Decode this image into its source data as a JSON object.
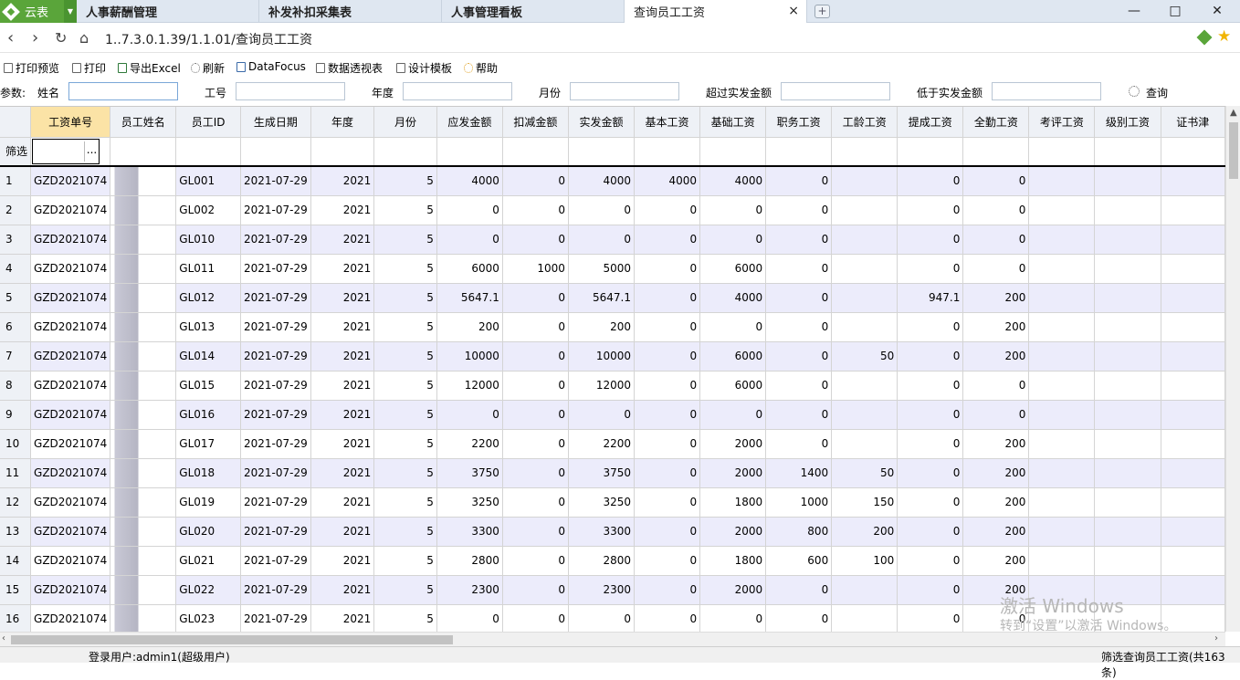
{
  "tabs": {
    "logo_label": "云表",
    "items": [
      "人事薪酬管理",
      "补发补扣采集表",
      "人事管理看板",
      "查询员工工资"
    ],
    "close_glyph": "×",
    "new_glyph": "+"
  },
  "window": {
    "minimize": "—",
    "maximize": "□",
    "close": "✕"
  },
  "address": {
    "url": "1..7.3.0.1.39/1.1.01/查询员工工资"
  },
  "toolbar": {
    "print_preview": "打印预览",
    "print": "打印",
    "export_excel": "导出Excel",
    "refresh": "刷新",
    "datafocus": "DataFocus",
    "pivot": "数据透视表",
    "design_template": "设计模板",
    "help": "帮助"
  },
  "params": {
    "label": "参数:",
    "name": "姓名",
    "emp_no": "工号",
    "year": "年度",
    "month": "月份",
    "above_amount": "超过实发金额",
    "below_amount": "低于实发金额",
    "query": "查询"
  },
  "grid": {
    "filter_label": "筛选",
    "filter_button": "...",
    "columns": [
      "工资单号",
      "员工姓名",
      "员工ID",
      "生成日期",
      "年度",
      "月份",
      "应发金额",
      "扣减金额",
      "实发金额",
      "基本工资",
      "基础工资",
      "职务工资",
      "工龄工资",
      "提成工资",
      "全勤工资",
      "考评工资",
      "级别工资",
      "证书津"
    ],
    "rows": [
      [
        "1",
        "GZD2021074",
        "",
        "GL001",
        "2021-07-29",
        "2021",
        "5",
        "4000",
        "0",
        "4000",
        "4000",
        "4000",
        "0",
        "",
        "0",
        "0",
        "",
        "",
        ""
      ],
      [
        "2",
        "GZD2021074",
        "",
        "GL002",
        "2021-07-29",
        "2021",
        "5",
        "0",
        "0",
        "0",
        "0",
        "0",
        "0",
        "",
        "0",
        "0",
        "",
        "",
        ""
      ],
      [
        "3",
        "GZD2021074",
        "",
        "GL010",
        "2021-07-29",
        "2021",
        "5",
        "0",
        "0",
        "0",
        "0",
        "0",
        "0",
        "",
        "0",
        "0",
        "",
        "",
        ""
      ],
      [
        "4",
        "GZD2021074",
        "",
        "GL011",
        "2021-07-29",
        "2021",
        "5",
        "6000",
        "1000",
        "5000",
        "0",
        "6000",
        "0",
        "",
        "0",
        "0",
        "",
        "",
        ""
      ],
      [
        "5",
        "GZD2021074",
        "",
        "GL012",
        "2021-07-29",
        "2021",
        "5",
        "5647.1",
        "0",
        "5647.1",
        "0",
        "4000",
        "0",
        "",
        "947.1",
        "200",
        "",
        "",
        ""
      ],
      [
        "6",
        "GZD2021074",
        "",
        "GL013",
        "2021-07-29",
        "2021",
        "5",
        "200",
        "0",
        "200",
        "0",
        "0",
        "0",
        "",
        "0",
        "200",
        "",
        "",
        ""
      ],
      [
        "7",
        "GZD2021074",
        "",
        "GL014",
        "2021-07-29",
        "2021",
        "5",
        "10000",
        "0",
        "10000",
        "0",
        "6000",
        "0",
        "50",
        "0",
        "200",
        "",
        "",
        ""
      ],
      [
        "8",
        "GZD2021074",
        "",
        "GL015",
        "2021-07-29",
        "2021",
        "5",
        "12000",
        "0",
        "12000",
        "0",
        "6000",
        "0",
        "",
        "0",
        "0",
        "",
        "",
        ""
      ],
      [
        "9",
        "GZD2021074",
        "",
        "GL016",
        "2021-07-29",
        "2021",
        "5",
        "0",
        "0",
        "0",
        "0",
        "0",
        "0",
        "",
        "0",
        "0",
        "",
        "",
        ""
      ],
      [
        "10",
        "GZD2021074",
        "",
        "GL017",
        "2021-07-29",
        "2021",
        "5",
        "2200",
        "0",
        "2200",
        "0",
        "2000",
        "0",
        "",
        "0",
        "200",
        "",
        "",
        ""
      ],
      [
        "11",
        "GZD2021074",
        "",
        "GL018",
        "2021-07-29",
        "2021",
        "5",
        "3750",
        "0",
        "3750",
        "0",
        "2000",
        "1400",
        "50",
        "0",
        "200",
        "",
        "",
        ""
      ],
      [
        "12",
        "GZD2021074",
        "",
        "GL019",
        "2021-07-29",
        "2021",
        "5",
        "3250",
        "0",
        "3250",
        "0",
        "1800",
        "1000",
        "150",
        "0",
        "200",
        "",
        "",
        ""
      ],
      [
        "13",
        "GZD2021074",
        "",
        "GL020",
        "2021-07-29",
        "2021",
        "5",
        "3300",
        "0",
        "3300",
        "0",
        "2000",
        "800",
        "200",
        "0",
        "200",
        "",
        "",
        ""
      ],
      [
        "14",
        "GZD2021074",
        "",
        "GL021",
        "2021-07-29",
        "2021",
        "5",
        "2800",
        "0",
        "2800",
        "0",
        "1800",
        "600",
        "100",
        "0",
        "200",
        "",
        "",
        ""
      ],
      [
        "15",
        "GZD2021074",
        "",
        "GL022",
        "2021-07-29",
        "2021",
        "5",
        "2300",
        "0",
        "2300",
        "0",
        "2000",
        "0",
        "",
        "0",
        "200",
        "",
        "",
        ""
      ],
      [
        "16",
        "GZD2021074",
        "",
        "GL023",
        "2021-07-29",
        "2021",
        "5",
        "0",
        "0",
        "0",
        "0",
        "0",
        "0",
        "",
        "0",
        "0",
        "",
        "",
        ""
      ]
    ]
  },
  "status": {
    "user": "登录用户:admin1(超级用户)",
    "filter_info": "筛选查询员工工资(共163条)"
  },
  "watermark": {
    "line1": "激活 Windows",
    "line2": "转到“设置”以激活 Windows。"
  },
  "colors": {
    "logo_green": "#5aa53a",
    "row_stripe": "#ececfb",
    "header_selected": "#fbe3a6"
  }
}
